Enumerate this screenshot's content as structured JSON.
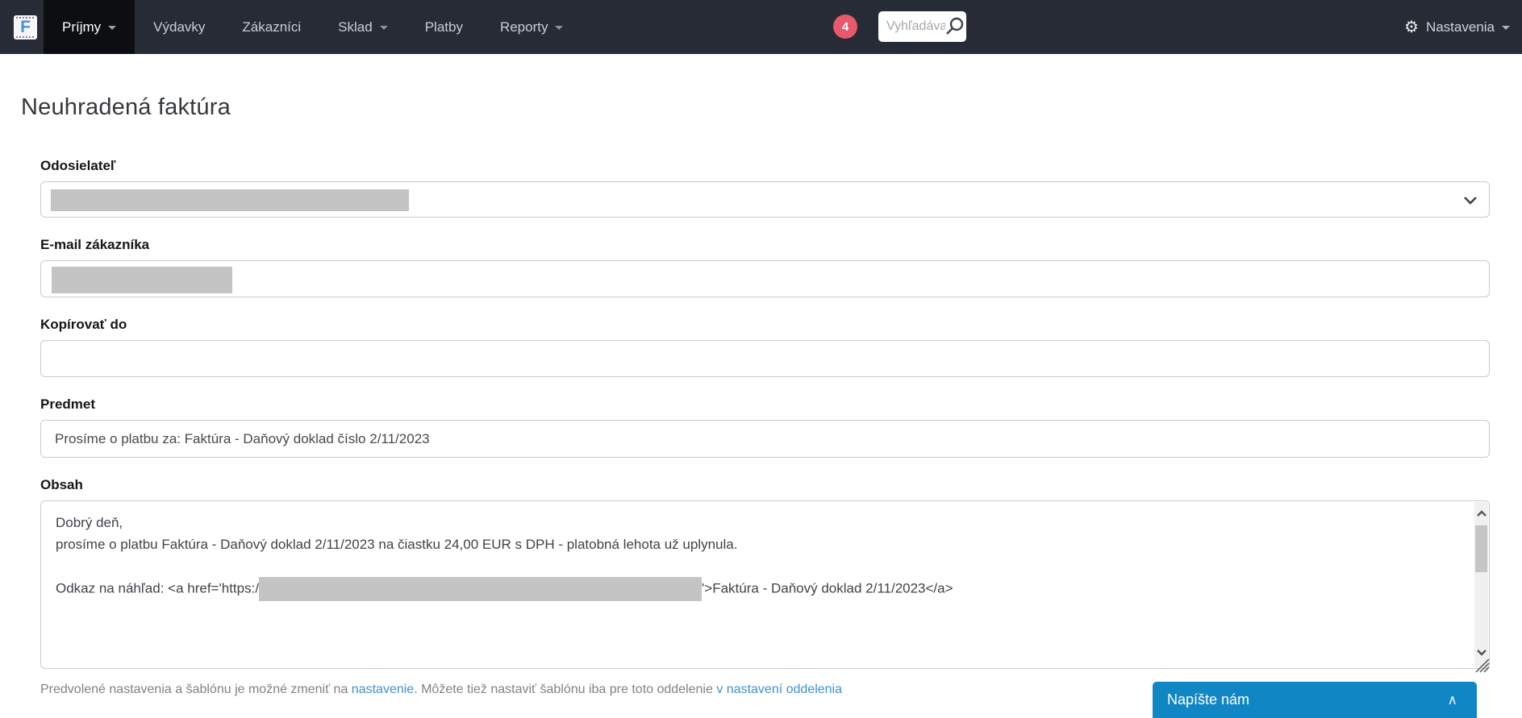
{
  "navbar": {
    "logo_letter": "F",
    "items": [
      {
        "label": "Príjmy"
      },
      {
        "label": "Výdavky"
      },
      {
        "label": "Zákazníci"
      },
      {
        "label": "Sklad"
      },
      {
        "label": "Platby"
      },
      {
        "label": "Reporty"
      }
    ],
    "badge_count": "4",
    "search_placeholder": "Vyhľadáva",
    "settings_label": "Nastavenia",
    "gear_icon": "⚙"
  },
  "page": {
    "title": "Neuhradená faktúra"
  },
  "form": {
    "sender": {
      "label": "Odosielateľ",
      "value_redacted": true
    },
    "email": {
      "label": "E-mail zákazníka",
      "value_redacted": true
    },
    "copy": {
      "label": "Kopírovať do",
      "value": ""
    },
    "subject": {
      "label": "Predmet",
      "value": "Prosíme o platbu za: Faktúra - Daňový doklad číslo 2/11/2023"
    },
    "content": {
      "label": "Obsah",
      "line1": "Dobrý deň,",
      "line2": "prosíme o platbu Faktúra - Daňový doklad 2/11/2023 na čiastku 24,00 EUR s DPH - platobná lehota už uplynula.",
      "line3_prefix": "Odkaz na náhľad: <a href='https:/",
      "line3_suffix": "'>Faktúra - Daňový doklad 2/11/2023</a>"
    }
  },
  "footer": {
    "text1": "Predvolené nastavenia a šablónu je možné zmeniť na ",
    "link1": "nastavenie.",
    "text2": " Môžete tiež nastaviť šablónu iba pre toto oddelenie ",
    "link2": "v nastavení oddelenia"
  },
  "chat": {
    "label": "Napíšte nám",
    "collapse_icon": "∧"
  },
  "colors": {
    "navbar_bg": "#272b35",
    "navbar_active_bg": "#0d0e12",
    "badge_red": "#e7596b",
    "link_blue": "#4090d2",
    "chat_blue": "#1186c5",
    "logo_blue": "#4a90d6"
  }
}
